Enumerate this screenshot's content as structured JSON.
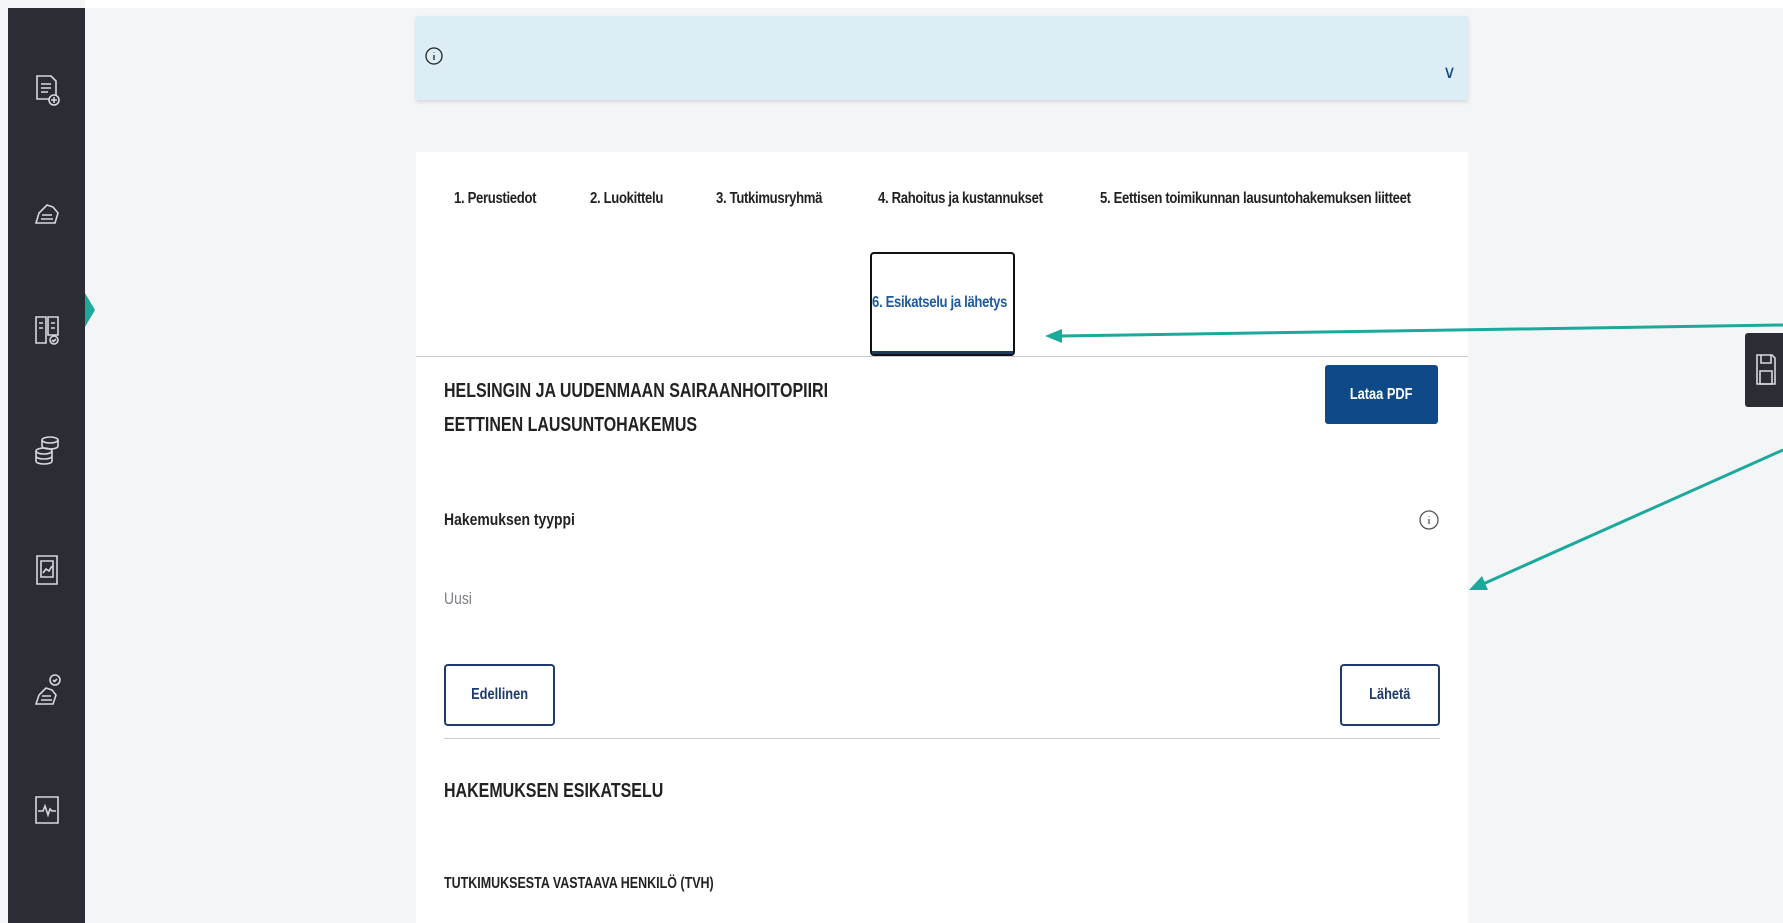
{
  "sidebar": {
    "icons": [
      "new-document-icon",
      "handshake-icon",
      "documents-check-icon",
      "coins-icon",
      "chart-report-icon",
      "handshake-check-icon",
      "pulse-icon"
    ]
  },
  "banner": {
    "expand_symbol": "∨"
  },
  "tabs": [
    {
      "label": "1. Perustiedot"
    },
    {
      "label": "2. Luokittelu"
    },
    {
      "label": "3. Tutkimusryhmä"
    },
    {
      "label": "4. Rahoitus ja kustannukset"
    },
    {
      "label": "5. Eettisen toimikunnan lausuntohakemuksen liitteet"
    },
    {
      "label": "6. Esikatselu ja lähetys"
    }
  ],
  "active_tab": "6. Esikatselu ja lähetys",
  "header": {
    "org_line1": "HELSINGIN JA UUDENMAAN SAIRAANHOITOPIIRI",
    "org_line2": "EETTINEN LAUSUNTOHAKEMUS",
    "download_pdf_label": "Lataa PDF"
  },
  "field": {
    "label": "Hakemuksen tyyppi",
    "value": "Uusi"
  },
  "buttons": {
    "previous_label": "Edellinen",
    "send_label": "Lähetä"
  },
  "preview": {
    "title": "HAKEMUKSEN ESIKATSELU",
    "subtitle": "TUTKIMUKSESTA VASTAAVA HENKILÖ (TVH)"
  },
  "colors": {
    "sidebar_bg": "#2a2d33",
    "accent_teal": "#1aa99a",
    "primary_button": "#0d4a87",
    "banner_bg": "#dcedf5",
    "active_tab_text": "#1e5aa0"
  }
}
